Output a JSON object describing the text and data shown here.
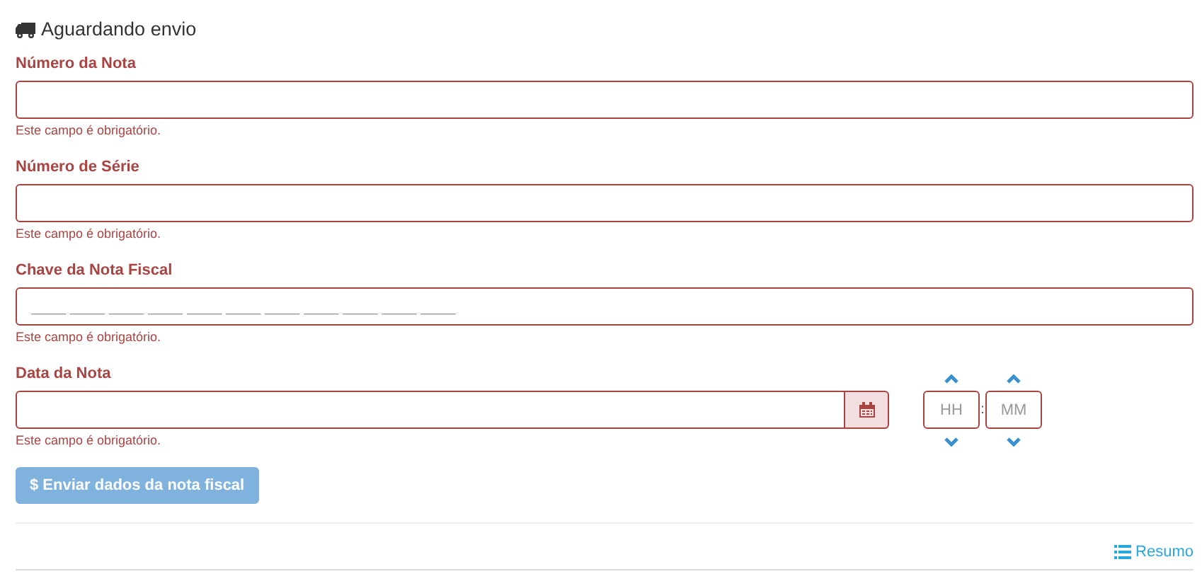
{
  "title": "Aguardando envio",
  "fields": [
    {
      "kind": "text",
      "label": "Número da Nota",
      "invalid": true,
      "error": "Este campo é obrigatório."
    },
    {
      "kind": "text",
      "label": "Número de Série",
      "invalid": true,
      "error": "Este campo é obrigatório."
    },
    {
      "kind": "masked",
      "label": "Chave da Nota Fiscal",
      "placeholder": "____ ____ ____ ____ ____ ____ ____ ____ ____ ____ ____",
      "invalid": true,
      "error": "Este campo é obrigatório."
    },
    {
      "kind": "date",
      "label": "Data da Nota",
      "invalid": true,
      "error": "Este campo é obrigatório."
    }
  ],
  "time": {
    "hours_placeholder": "HH",
    "separator": ":",
    "minutes_placeholder": "MM"
  },
  "submit": {
    "icon": "$",
    "label": "Enviar dados da nota fiscal",
    "disabled": true
  },
  "summary_link": "Resumo"
}
